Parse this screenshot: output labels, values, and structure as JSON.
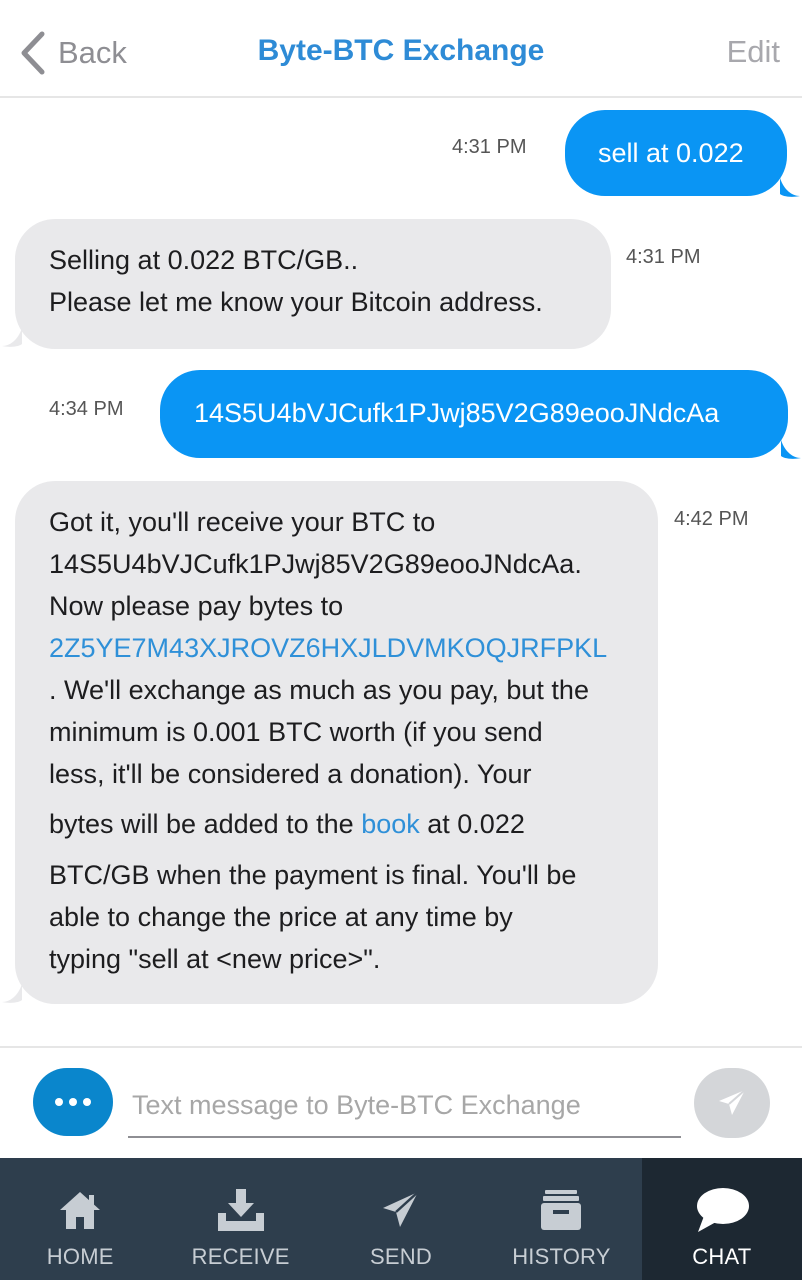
{
  "header": {
    "back_label": "Back",
    "title": "Byte-BTC Exchange",
    "edit_label": "Edit"
  },
  "messages": [
    {
      "direction": "out",
      "time": "4:31 PM",
      "text": "sell at 0.022"
    },
    {
      "direction": "in",
      "time": "4:31 PM",
      "line1": "Selling at 0.022 BTC/GB..",
      "line2": "Please let me know your Bitcoin address."
    },
    {
      "direction": "out",
      "time": "4:34 PM",
      "text": "14S5U4bVJCufk1PJwj85V2G89eooJNdcAa"
    },
    {
      "direction": "in",
      "time": "4:42 PM",
      "line1": "Got it, you'll receive your BTC to",
      "line2": "14S5U4bVJCufk1PJwj85V2G89eooJNdcAa.",
      "line3": "Now please pay bytes to",
      "address_link": "2Z5YE7M43XJROVZ6HXJLDVMKOQJRFPKL",
      "line5": ". We'll exchange as much as you pay, but the",
      "line6": "minimum is 0.001 BTC worth (if you send",
      "line7": "less, it'll be considered a donation). Your",
      "line8_before": "bytes will be added to the ",
      "book_link": "book",
      "line8_after": " at 0.022",
      "line9": "BTC/GB when the payment is final. You'll be",
      "line10": "able to change the price at any time by",
      "line11": "typing \"sell at <new price>\"."
    }
  ],
  "composer": {
    "placeholder": "Text message to Byte-BTC Exchange"
  },
  "tabs": [
    {
      "label": "HOME",
      "icon": "home-icon"
    },
    {
      "label": "RECEIVE",
      "icon": "receive-icon"
    },
    {
      "label": "SEND",
      "icon": "send-icon"
    },
    {
      "label": "HISTORY",
      "icon": "history-icon"
    },
    {
      "label": "CHAT",
      "icon": "chat-icon",
      "active": true
    }
  ],
  "colors": {
    "accent": "#2e8bd6",
    "outgoing_bubble": "#0a95f4",
    "incoming_bubble": "#e9e9eb",
    "tabbar": "#2e3e4d",
    "tabbar_active": "#1d2832"
  }
}
